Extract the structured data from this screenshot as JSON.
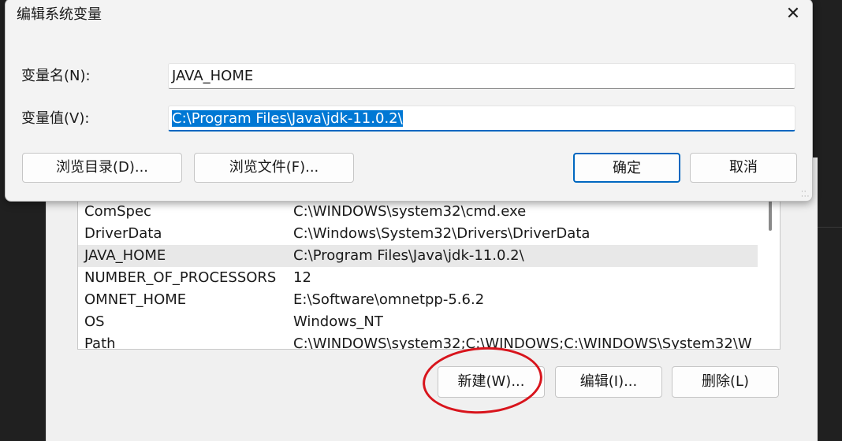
{
  "dialog": {
    "title": "编辑系统变量",
    "name_label": "变量名(N):",
    "name_value": "JAVA_HOME",
    "value_label": "变量值(V):",
    "value_value": "C:\\Program Files\\Java\\jdk-11.0.2\\",
    "browse_dir": "浏览目录(D)...",
    "browse_file": "浏览文件(F)...",
    "ok": "确定",
    "cancel": "取消",
    "close_icon": "close-icon"
  },
  "variables": [
    {
      "name": "ComSpec",
      "value": "C:\\WINDOWS\\system32\\cmd.exe"
    },
    {
      "name": "DriverData",
      "value": "C:\\Windows\\System32\\Drivers\\DriverData"
    },
    {
      "name": "JAVA_HOME",
      "value": "C:\\Program Files\\Java\\jdk-11.0.2\\"
    },
    {
      "name": "NUMBER_OF_PROCESSORS",
      "value": "12"
    },
    {
      "name": "OMNET_HOME",
      "value": "E:\\Software\\omnetpp-5.6.2"
    },
    {
      "name": "OS",
      "value": "Windows_NT"
    },
    {
      "name": "Path",
      "value": "C:\\WINDOWS\\system32;C:\\WINDOWS;C:\\WINDOWS\\System32\\W"
    }
  ],
  "buttons": {
    "new": "新建(W)...",
    "edit": "编辑(I)...",
    "delete": "删除(L)"
  },
  "colors": {
    "accent": "#0067c0",
    "selection": "#0078d4",
    "annotation": "#d8141c"
  }
}
